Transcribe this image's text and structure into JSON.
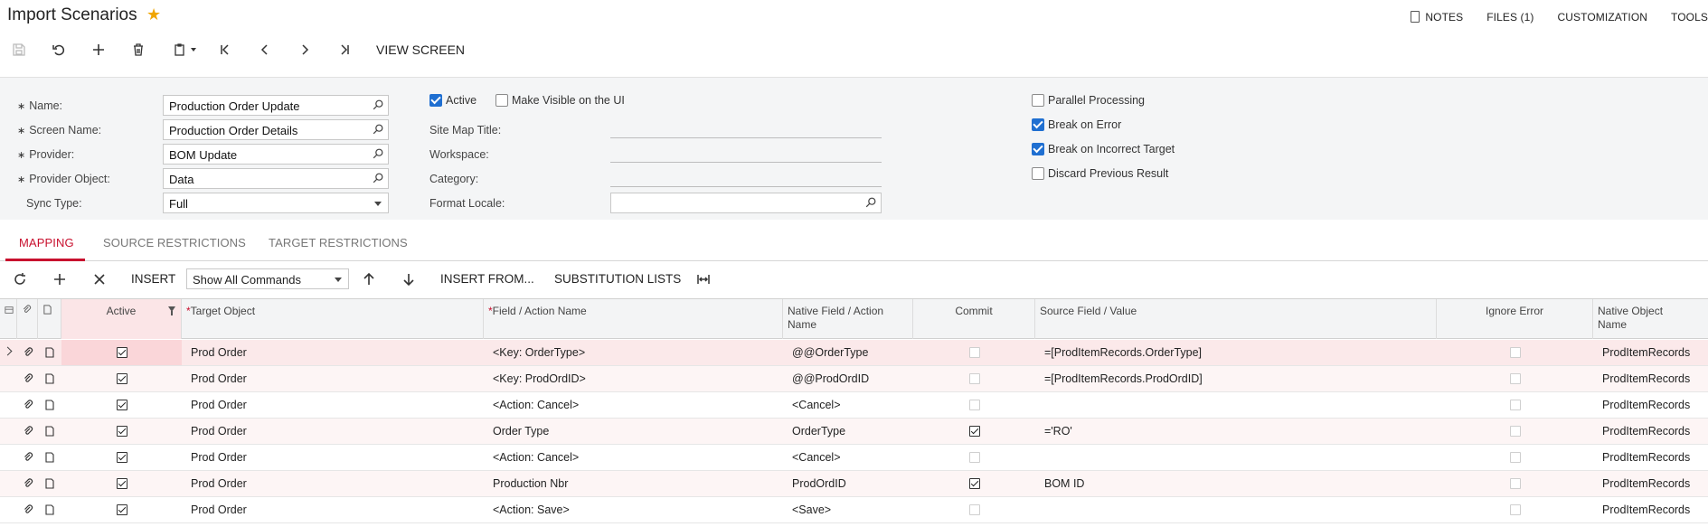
{
  "header": {
    "title": "Import Scenarios",
    "links": [
      "NOTES",
      "FILES (1)",
      "CUSTOMIZATION",
      "TOOLS"
    ]
  },
  "toolbar": {
    "view_screen": "VIEW SCREEN"
  },
  "form": {
    "name_label": "Name:",
    "name_value": "Production Order Update",
    "screen_name_label": "Screen Name:",
    "screen_name_value": "Production Order Details",
    "provider_label": "Provider:",
    "provider_value": "BOM Update",
    "provider_object_label": "Provider Object:",
    "provider_object_value": "Data",
    "sync_type_label": "Sync Type:",
    "sync_type_value": "Full",
    "active_label": "Active",
    "active_checked": true,
    "make_visible_label": "Make Visible on the UI",
    "make_visible_checked": false,
    "site_map_title_label": "Site Map Title:",
    "workspace_label": "Workspace:",
    "category_label": "Category:",
    "format_locale_label": "Format Locale:",
    "parallel_processing_label": "Parallel Processing",
    "parallel_processing_checked": false,
    "break_on_error_label": "Break on Error",
    "break_on_error_checked": true,
    "break_on_incorrect_target_label": "Break on Incorrect Target",
    "break_on_incorrect_target_checked": true,
    "discard_previous_result_label": "Discard Previous Result",
    "discard_previous_result_checked": false
  },
  "tabs": {
    "mapping": "MAPPING",
    "source_restrictions": "SOURCE RESTRICTIONS",
    "target_restrictions": "TARGET RESTRICTIONS"
  },
  "grid_toolbar": {
    "insert": "INSERT",
    "command_filter": "Show All Commands",
    "insert_from": "INSERT FROM...",
    "substitution_lists": "SUBSTITUTION LISTS"
  },
  "grid": {
    "columns": {
      "active": "Active",
      "target_object": "Target Object",
      "field_action_name": "Field / Action Name",
      "native_field_line1": "Native Field / Action",
      "native_field_line2": "Name",
      "commit": "Commit",
      "source_field_value": "Source Field / Value",
      "ignore_error": "Ignore Error",
      "native_object_line1": "Native Object",
      "native_object_line2": "Name"
    },
    "rows": [
      {
        "active": true,
        "target_object": "Prod Order",
        "field": "<Key: OrderType>",
        "native_field": "@@OrderType",
        "commit": false,
        "source": "=[ProdItemRecords.OrderType]",
        "ignore_error": false,
        "native_object": "ProdItemRecords"
      },
      {
        "active": true,
        "target_object": "Prod Order",
        "field": "<Key: ProdOrdID>",
        "native_field": "@@ProdOrdID",
        "commit": false,
        "source": "=[ProdItemRecords.ProdOrdID]",
        "ignore_error": false,
        "native_object": "ProdItemRecords"
      },
      {
        "active": true,
        "target_object": "Prod Order",
        "field": "<Action: Cancel>",
        "native_field": "<Cancel>",
        "commit": false,
        "source": "",
        "ignore_error": false,
        "native_object": "ProdItemRecords"
      },
      {
        "active": true,
        "target_object": "Prod Order",
        "field": "Order Type",
        "native_field": "OrderType",
        "commit": true,
        "source": "='RO'",
        "ignore_error": false,
        "native_object": "ProdItemRecords"
      },
      {
        "active": true,
        "target_object": "Prod Order",
        "field": "<Action: Cancel>",
        "native_field": "<Cancel>",
        "commit": false,
        "source": "",
        "ignore_error": false,
        "native_object": "ProdItemRecords"
      },
      {
        "active": true,
        "target_object": "Prod Order",
        "field": "Production Nbr",
        "native_field": "ProdOrdID",
        "commit": true,
        "source": "BOM ID",
        "ignore_error": false,
        "native_object": "ProdItemRecords"
      },
      {
        "active": true,
        "target_object": "Prod Order",
        "field": "<Action: Save>",
        "native_field": "<Save>",
        "commit": false,
        "source": "",
        "ignore_error": false,
        "native_object": "ProdItemRecords"
      }
    ]
  },
  "colors": {
    "accent_red": "#c8102e",
    "check_blue": "#1f6fd1",
    "star": "#f0a500"
  }
}
